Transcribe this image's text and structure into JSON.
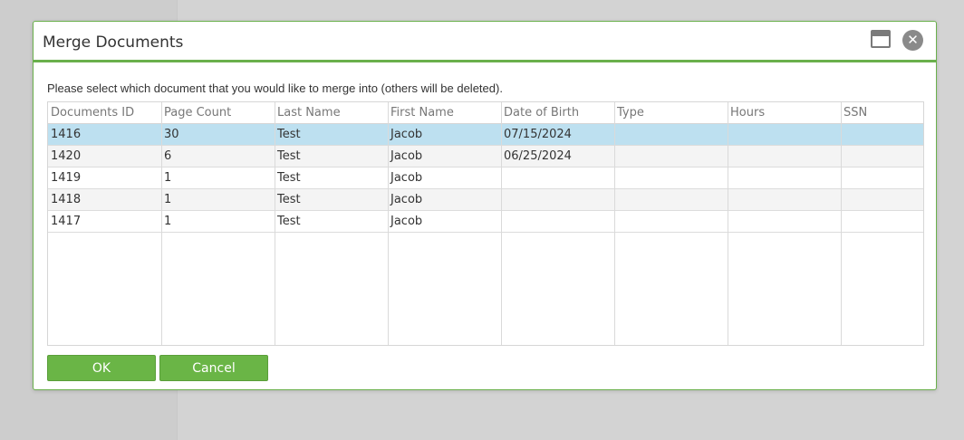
{
  "dialog": {
    "title": "Merge Documents",
    "instruction": "Please select which document that you would like to merge into (others will be deleted).",
    "maximize_icon": "window-maximize-icon",
    "close_icon": "close-icon",
    "close_glyph": "✕"
  },
  "table": {
    "columns": [
      "Documents ID",
      "Page Count",
      "Last Name",
      "First Name",
      "Date of Birth",
      "Type",
      "Hours",
      "SSN"
    ],
    "rows": [
      [
        "1416",
        "30",
        "Test",
        "Jacob",
        "07/15/2024",
        "",
        "",
        ""
      ],
      [
        "1420",
        "6",
        "Test",
        "Jacob",
        "06/25/2024",
        "",
        "",
        ""
      ],
      [
        "1419",
        "1",
        "Test",
        "Jacob",
        "",
        "",
        "",
        ""
      ],
      [
        "1418",
        "1",
        "Test",
        "Jacob",
        "",
        "",
        "",
        ""
      ],
      [
        "1417",
        "1",
        "Test",
        "Jacob",
        "",
        "",
        "",
        ""
      ]
    ],
    "selected_row": 0
  },
  "buttons": {
    "ok_label": "OK",
    "cancel_label": "Cancel"
  },
  "colors": {
    "accent": "#6ab04c",
    "button": "#6ab546",
    "selected_row": "#bde0f0",
    "alt_row": "#f4f4f4",
    "background": "#d3d3d3"
  }
}
